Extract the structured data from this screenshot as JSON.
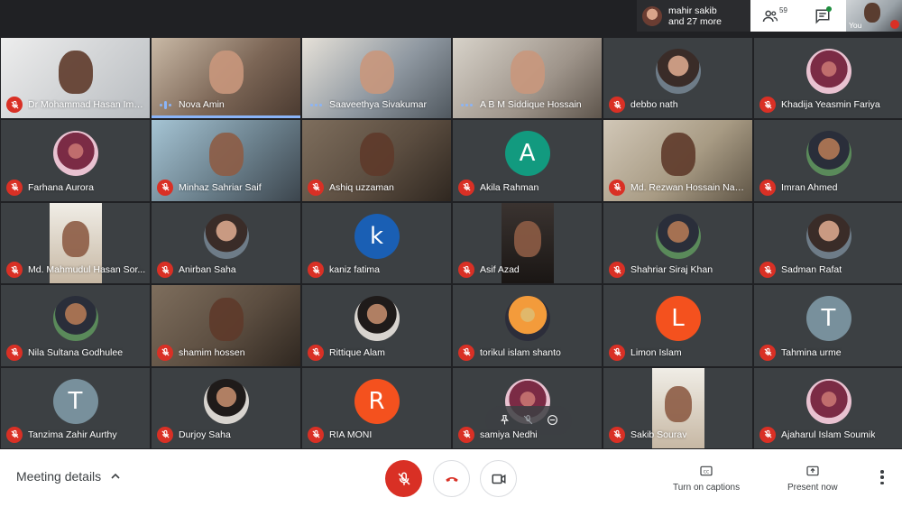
{
  "topbar": {
    "presenter_chip": {
      "name": "mahir sakib",
      "more": "and 27 more"
    },
    "people_count": "59",
    "self_label": "You"
  },
  "participants": [
    {
      "name": "Dr Mohammad Hasan Imam",
      "mic": "muted",
      "view": "video",
      "bg": "bg0",
      "face": "dark"
    },
    {
      "name": "Nova Amin",
      "mic": "speaking",
      "view": "video",
      "bg": "bg1",
      "face": "light"
    },
    {
      "name": "Saaveethya Sivakumar",
      "mic": "idle",
      "view": "video",
      "bg": "bg2",
      "face": "light"
    },
    {
      "name": "A B M Siddique Hossain",
      "mic": "idle",
      "view": "video",
      "bg": "bg3",
      "face": "light"
    },
    {
      "name": "debbo nath",
      "mic": "muted",
      "view": "avatar",
      "avatar": "photo"
    },
    {
      "name": "Khadija Yeasmin Fariya",
      "mic": "muted",
      "view": "avatar",
      "avatar": "photo5"
    },
    {
      "name": "Farhana Aurora",
      "mic": "muted",
      "view": "avatar",
      "avatar": "photo5"
    },
    {
      "name": "Minhaz Sahriar Saif",
      "mic": "muted",
      "view": "video",
      "bg": "bg4",
      "face": "mid"
    },
    {
      "name": "Ashiq uzzaman",
      "mic": "muted",
      "view": "video",
      "bg": "bg7",
      "face": "dark"
    },
    {
      "name": "Akila Rahman",
      "mic": "muted",
      "view": "letter",
      "letter": "A",
      "color": "#129a7f"
    },
    {
      "name": "Md. Rezwan Hossain Naee...",
      "mic": "muted",
      "view": "video",
      "bg": "bg6",
      "face": "dark"
    },
    {
      "name": "Imran Ahmed",
      "mic": "muted",
      "view": "avatar",
      "avatar": "photo3"
    },
    {
      "name": "Md. Mahmudul Hasan Sor...",
      "mic": "muted",
      "view": "portrait",
      "portrait": "light"
    },
    {
      "name": "Anirban Saha",
      "mic": "muted",
      "view": "avatar",
      "avatar": "photo"
    },
    {
      "name": "kaniz fatima",
      "mic": "muted",
      "view": "letter",
      "letter": "k",
      "color": "#1a5fb4"
    },
    {
      "name": "Asif Azad",
      "mic": "muted",
      "view": "portrait",
      "portrait": "dark"
    },
    {
      "name": "Shahriar Siraj Khan",
      "mic": "muted",
      "view": "avatar",
      "avatar": "photo3"
    },
    {
      "name": "Sadman Rafat",
      "mic": "muted",
      "view": "avatar",
      "avatar": "photo"
    },
    {
      "name": "Nila Sultana Godhulee",
      "mic": "muted",
      "view": "avatar",
      "avatar": "photo3"
    },
    {
      "name": "shamim hossen",
      "mic": "muted",
      "view": "video",
      "bg": "bg7",
      "face": "dark"
    },
    {
      "name": "Rittique Alam",
      "mic": "muted",
      "view": "avatar",
      "avatar": "photo2"
    },
    {
      "name": "torikul islam shanto",
      "mic": "muted",
      "view": "avatar",
      "avatar": "photo4"
    },
    {
      "name": "Limon Islam",
      "mic": "muted",
      "view": "letter",
      "letter": "L",
      "color": "#f4511e"
    },
    {
      "name": "Tahmina urme",
      "mic": "muted",
      "view": "letter",
      "letter": "T",
      "color": "#78909c"
    },
    {
      "name": "Tanzima Zahir Aurthy",
      "mic": "muted",
      "view": "letter",
      "letter": "T",
      "color": "#78909c"
    },
    {
      "name": "Durjoy Saha",
      "mic": "muted",
      "view": "avatar",
      "avatar": "photo2"
    },
    {
      "name": "RIA MONI",
      "mic": "muted",
      "view": "letter",
      "letter": "R",
      "color": "#f4511e"
    },
    {
      "name": "samiya Nedhi",
      "mic": "muted",
      "view": "avatar",
      "avatar": "photo5",
      "hover": true
    },
    {
      "name": "Sakib Sourav",
      "mic": "muted",
      "view": "portrait",
      "portrait": "light"
    },
    {
      "name": "Ajaharul Islam Soumik",
      "mic": "muted",
      "view": "avatar",
      "avatar": "photo5"
    }
  ],
  "bottombar": {
    "meeting_details": "Meeting details",
    "captions": "Turn on captions",
    "present": "Present now"
  },
  "colors": {
    "red": "#d93025",
    "speaking": "#8ab4f8",
    "background": "#202124"
  }
}
